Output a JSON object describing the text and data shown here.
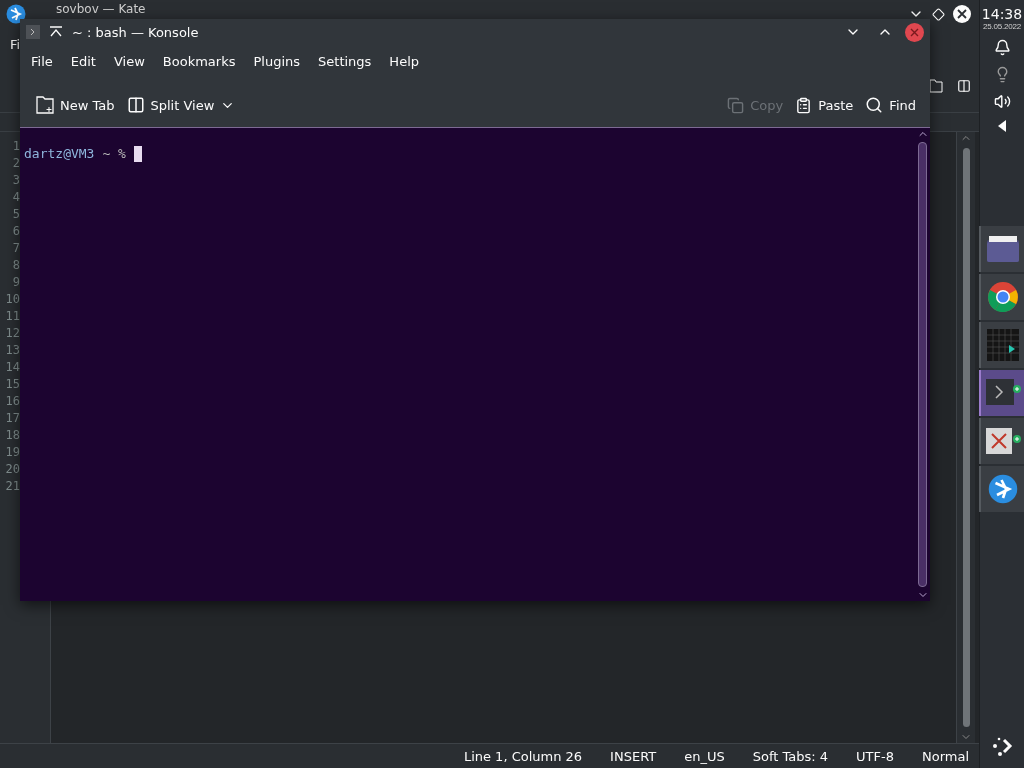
{
  "kate": {
    "title": "sovbov — Kate",
    "menu_fragment": "Fi",
    "line_numbers": [
      "1",
      "2",
      "3",
      "4",
      "5",
      "6",
      "7",
      "8",
      "9",
      "10",
      "11",
      "12",
      "13",
      "14",
      "15",
      "16",
      "17",
      "18",
      "19",
      "20",
      "21"
    ],
    "status_bar": [
      "Line 1, Column 26",
      "INSERT",
      "en_US",
      "Soft Tabs: 4",
      "UTF-8",
      "Normal"
    ]
  },
  "konsole": {
    "title": "~ : bash — Konsole",
    "menu": [
      "File",
      "Edit",
      "View",
      "Bookmarks",
      "Plugins",
      "Settings",
      "Help"
    ],
    "toolbar_left": [
      {
        "kind": "new-tab",
        "label": "New Tab",
        "disabled": false
      },
      {
        "kind": "split-view",
        "label": "Split View",
        "disabled": false
      }
    ],
    "toolbar_right": [
      {
        "kind": "copy",
        "label": "Copy",
        "disabled": true
      },
      {
        "kind": "paste",
        "label": "Paste",
        "disabled": false
      },
      {
        "kind": "find",
        "label": "Find",
        "disabled": false
      }
    ],
    "prompt": {
      "user_host": "dartz@VM3",
      "rest": "~ %"
    }
  },
  "panel": {
    "time": "14:38",
    "date": "25.05.2022",
    "tasks": [
      {
        "kind": "folder",
        "selected": false
      },
      {
        "kind": "browser",
        "selected": false
      },
      {
        "kind": "monitor",
        "selected": false
      },
      {
        "kind": "terminal",
        "selected": true
      },
      {
        "kind": "xapp",
        "selected": false
      },
      {
        "kind": "logo",
        "selected": false
      }
    ]
  }
}
